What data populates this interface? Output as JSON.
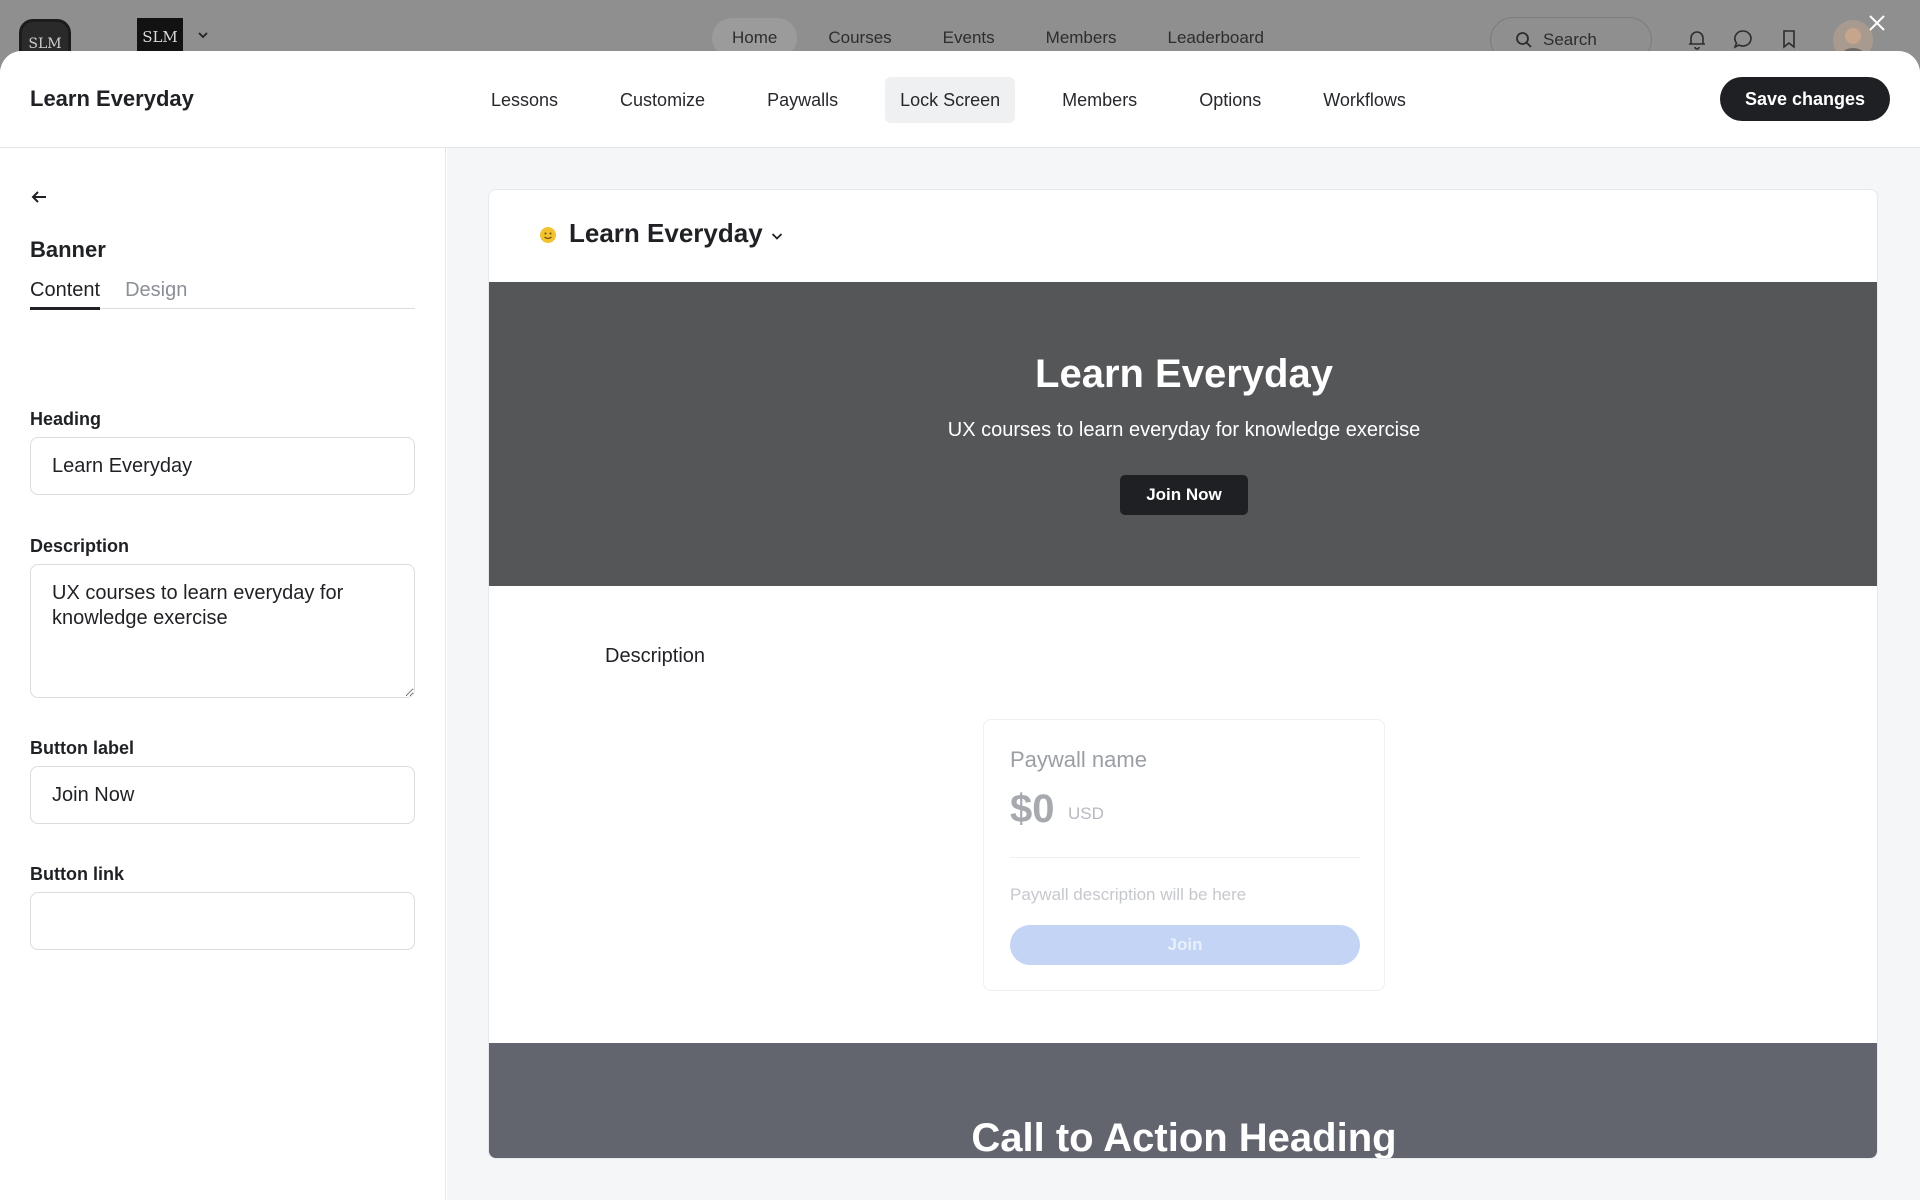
{
  "background": {
    "logo_primary": "SLM",
    "logo_secondary": "SLM",
    "nav": [
      "Home",
      "Courses",
      "Events",
      "Members",
      "Leaderboard"
    ],
    "search_label": "Search"
  },
  "modal": {
    "title": "Learn Everyday",
    "tabs": [
      "Lessons",
      "Customize",
      "Paywalls",
      "Lock Screen",
      "Members",
      "Options",
      "Workflows"
    ],
    "active_tab": "Lock Screen",
    "save_label": "Save changes"
  },
  "sidebar": {
    "section_title": "Banner",
    "subtabs": [
      "Content",
      "Design"
    ],
    "heading_label": "Heading",
    "heading_value": "Learn Everyday",
    "description_label": "Description",
    "description_value": "UX courses to learn everyday for knowledge exercise",
    "button_label_label": "Button label",
    "button_label_value": "Join Now",
    "button_link_label": "Button link",
    "button_link_value": ""
  },
  "preview": {
    "title": "Learn Everyday",
    "banner_heading": "Learn Everyday",
    "banner_description": "UX courses to learn everyday for knowledge exercise",
    "banner_button": "Join Now",
    "description_label": "Description",
    "paywall": {
      "name": "Paywall name",
      "price": "$0",
      "currency": "USD",
      "description": "Paywall description will be here",
      "button": "Join"
    },
    "cta_heading": "Call to Action Heading"
  },
  "colors": {
    "primary_dark": "#1e2024",
    "banner_bg": "#555658",
    "cta_bg": "#62646e",
    "paywall_button": "#c3d4f5"
  }
}
